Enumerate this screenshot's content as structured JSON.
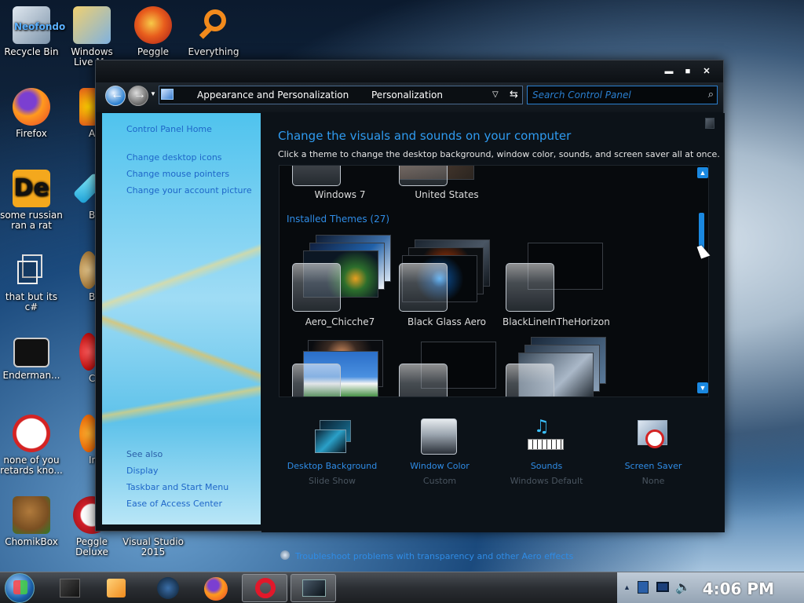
{
  "desktop": {
    "icons": [
      {
        "label": "Recycle Bin",
        "overlay": "Neofondo"
      },
      {
        "label": "Windows Live Ma"
      },
      {
        "label": "Peggle"
      },
      {
        "label": "Everything"
      },
      {
        "label": "Firefox"
      },
      {
        "label": "Astro Delu"
      },
      {
        "label": "some russian ran a rat"
      },
      {
        "label": "Bejew Delu"
      },
      {
        "label": "that but its c#"
      },
      {
        "label": "Big M Delu"
      },
      {
        "label": "Enderman..."
      },
      {
        "label": "Chuz Delu"
      },
      {
        "label": "none of you retards kno..."
      },
      {
        "label": "Insaniq Delu"
      },
      {
        "label": "ChomikBox"
      },
      {
        "label": "Peggle Deluxe"
      },
      {
        "label": "Visual Studio 2015"
      }
    ]
  },
  "window": {
    "controls": {
      "minimize": "▬",
      "maximize": "■",
      "close": "✕"
    },
    "address": {
      "crumb1": "Appearance and Personalization",
      "crumb2": "Personalization"
    },
    "search_placeholder": "Search Control Panel",
    "sidebar": {
      "home": "Control Panel Home",
      "links": [
        "Change desktop icons",
        "Change mouse pointers",
        "Change your account picture"
      ],
      "see_also": "See also",
      "see_also_links": [
        "Display",
        "Taskbar and Start Menu",
        "Ease of Access Center"
      ]
    },
    "main": {
      "title": "Change the visuals and sounds on your computer",
      "subtitle": "Click a theme to change the desktop background, window color, sounds, and screen saver all at once.",
      "top_themes": [
        "Windows 7",
        "United States"
      ],
      "installed_label": "Installed Themes (27)",
      "themes": [
        "Aero_Chicche7",
        "Black Glass Aero",
        "BlackLineInTheHorizon"
      ],
      "bottom": [
        {
          "title": "Desktop Background",
          "sub": "Slide Show"
        },
        {
          "title": "Window Color",
          "sub": "Custom"
        },
        {
          "title": "Sounds",
          "sub": "Windows Default"
        },
        {
          "title": "Screen Saver",
          "sub": "None"
        }
      ],
      "troubleshoot": "Troubleshoot problems with transparency and other Aero effects"
    }
  },
  "taskbar": {
    "clock": "4:06 PM"
  }
}
